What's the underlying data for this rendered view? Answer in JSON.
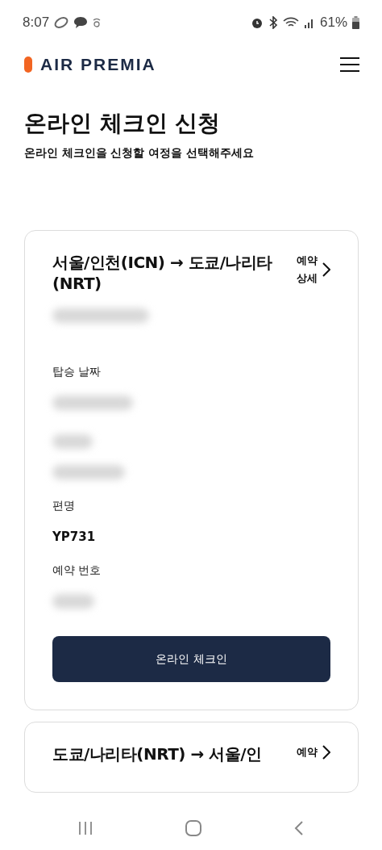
{
  "status_bar": {
    "time": "8:07",
    "battery": "61%"
  },
  "header": {
    "logo": "AIR PREMIA"
  },
  "page": {
    "title": "온라인 체크인 신청",
    "subtitle": "온라인 체크인을 신청할 여정을 선택해주세요"
  },
  "trips": [
    {
      "route": "서울/인천(ICN) → 도쿄/나리타(NRT)",
      "detail_link": "예약 상세",
      "fields": [
        {
          "label": "탑승 날짜",
          "kind": "blurred_multi"
        },
        {
          "label": "편명",
          "kind": "text",
          "value": "YP731"
        },
        {
          "label": "예약 번호",
          "kind": "blurred"
        }
      ],
      "button": "온라인 체크인"
    },
    {
      "route": "도쿄/나리타(NRT) → 서울/인",
      "detail_link": "예약"
    }
  ]
}
